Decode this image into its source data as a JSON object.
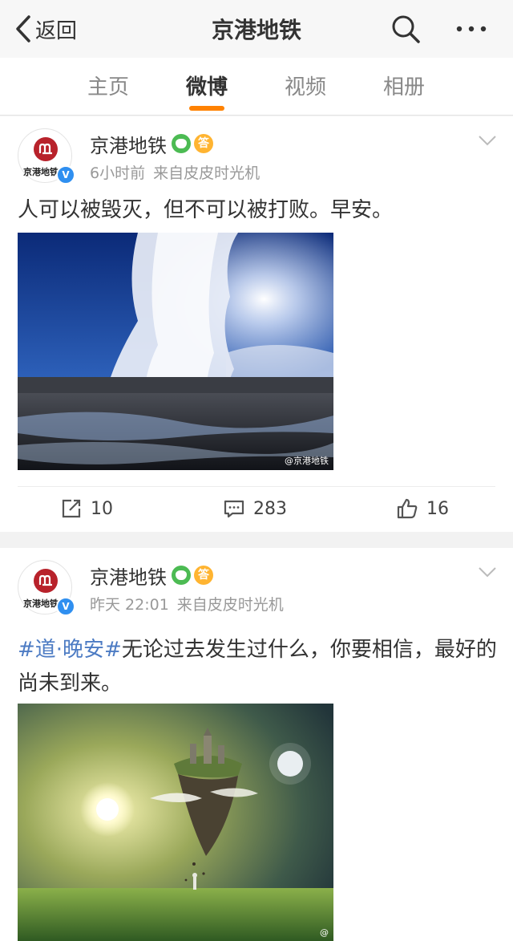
{
  "nav": {
    "back_label": "返回",
    "title": "京港地铁",
    "search_icon": "search-icon",
    "more_icon": "more-icon"
  },
  "tabs": [
    {
      "label": "主页",
      "active": false
    },
    {
      "label": "微博",
      "active": true
    },
    {
      "label": "视频",
      "active": false
    },
    {
      "label": "相册",
      "active": false
    }
  ],
  "colors": {
    "accent": "#ff8200",
    "link": "#4c7bc3",
    "verified": "#2f8ff0",
    "logo_red": "#b8222b"
  },
  "posts": [
    {
      "author": "京港地铁",
      "avatar_text": "京港地铁",
      "time": "6小时前",
      "source": "来自皮皮时光机",
      "text": "人可以被毁灭，但不可以被打败。早安。",
      "image_watermark": "@京港地铁",
      "repost_count": "10",
      "comment_count": "283",
      "like_count": "16"
    },
    {
      "author": "京港地铁",
      "avatar_text": "京港地铁",
      "time": "昨天 22:01",
      "source": "来自皮皮时光机",
      "hashtag": "#道·晚安#",
      "text": "无论过去发生过什么，你要相信，最好的尚未到来。",
      "image_watermark": "@"
    }
  ]
}
